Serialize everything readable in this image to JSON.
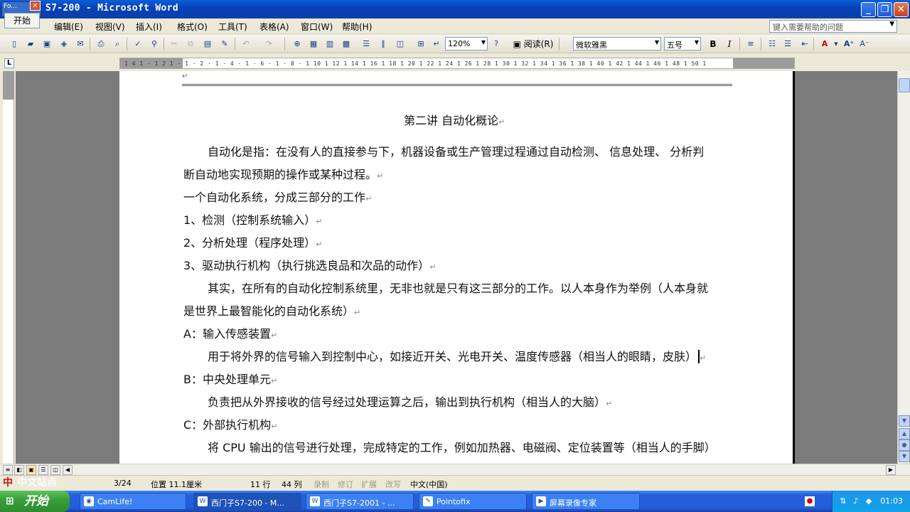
{
  "window": {
    "title": "S7-200 - Microsoft Word",
    "mini_app_label": "Fo...",
    "start_overlay": "开始"
  },
  "menu": [
    "编辑(E)",
    "视图(V)",
    "插入(I)",
    "格式(O)",
    "工具(T)",
    "表格(A)",
    "窗口(W)",
    "帮助(H)"
  ],
  "help_box": {
    "placeholder": "键入需要帮助的问题"
  },
  "toolbar": {
    "zoom": "120%",
    "read_label": "阅读(R)",
    "font": "微软雅黑",
    "size": "五号",
    "bold": "B",
    "italic": "I"
  },
  "ruler": {
    "corner": "L",
    "ticks": "1 4 1 · 1 2 1 · 1 · 2 · 1 · 4 · 1 · 6 · 1 · 8 · 1 10 1 12 1 14 1 16 1 18 1 20 1 22 1 24 1 26 1 28 1 30 1 32 1 34 1 36 1 38 1 40 1 42 1 44 1 46 1 48 1 50 1"
  },
  "document": {
    "title": "第二讲   自动化概论",
    "lines": [
      "自动化是指：在没有人的直接参与下，机器设备或生产管理过程通过自动检测、 信息处理、 分析判",
      "断自动地实现预期的操作或某种过程。",
      "一个自动化系统，分成三部分的工作",
      "1、检测（控制系统输入）",
      "2、分析处理（程序处理）",
      "3、驱动执行机构（执行挑选良品和次品的动作）",
      "其实，在所有的自动化控制系统里，无非也就是只有这三部分的工作。以人本身作为举例（人本身就",
      "是世界上最智能化的自动化系统）",
      "A：输入传感装置",
      "用于将外界的信号输入到控制中心，如接近开关、光电开关、温度传感器（相当人的眼睛，皮肤）",
      "B：中央处理单元",
      "负责把从外界接收的信号经过处理运算之后，输出到执行机构（相当人的大脑）",
      "C：外部执行机构",
      "将 CPU 输出的信号进行处理，完成特定的工作，例如加热器、电磁阀、定位装置等（相当人的手脚）"
    ],
    "paragraph_mark": "↵"
  },
  "status": {
    "page": "3/24",
    "position": "位置 11.1厘米",
    "line": "11 行",
    "col": "44 列",
    "rec": "录制",
    "trk": "修订",
    "ext": "扩展",
    "ovr": "改写",
    "lang": "中文(中国)"
  },
  "taskbar": {
    "start": "开始",
    "tasks": [
      "CamLife!",
      "西门子S7-200 - M...",
      "西门子S7-2001 - ...",
      "Pointofix",
      "屏幕录像专家"
    ],
    "clock": "01:03"
  },
  "watermark": "中文站点"
}
